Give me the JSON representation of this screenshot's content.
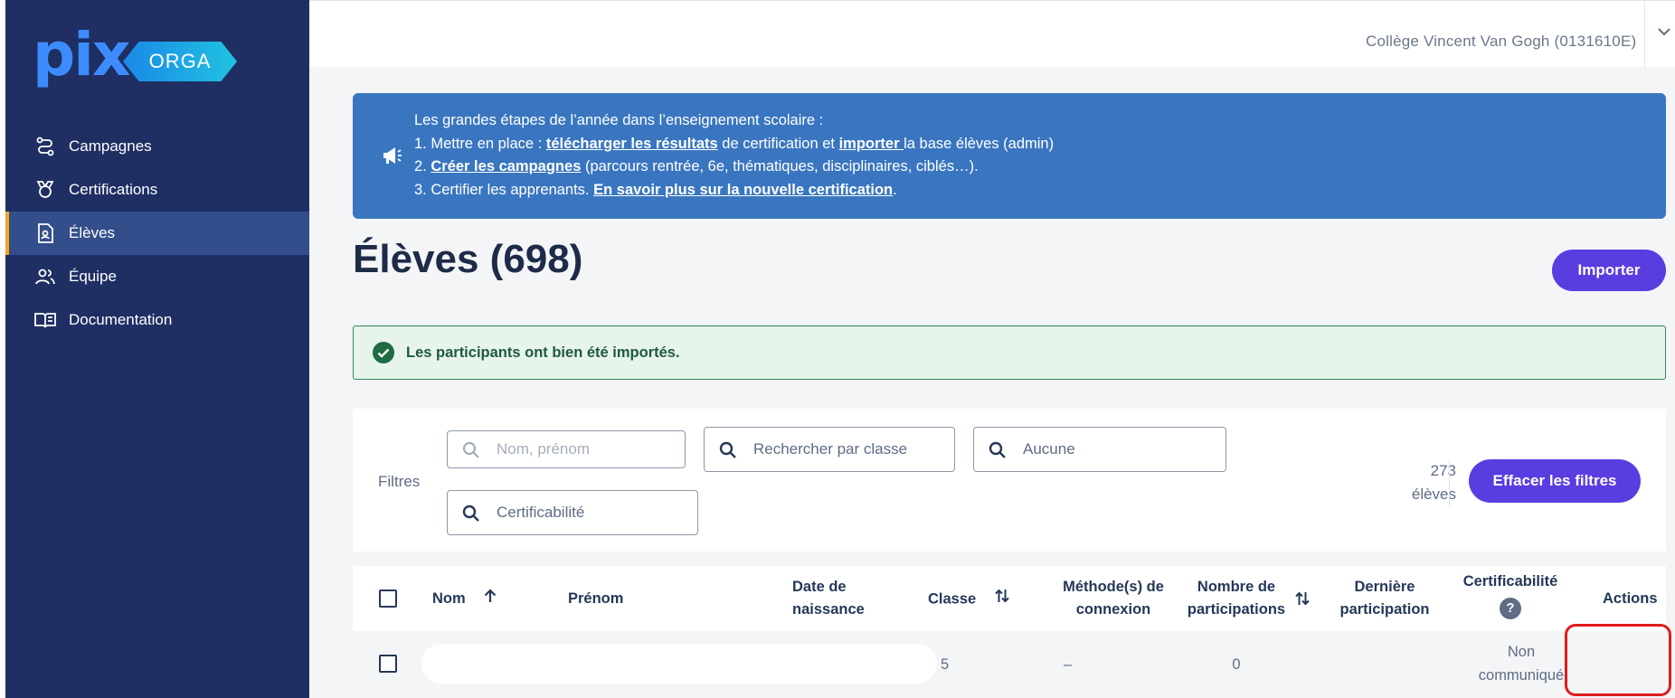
{
  "brand": {
    "name": "pix",
    "badge": "ORGA"
  },
  "sidebar": {
    "items": [
      {
        "label": "Campagnes",
        "icon": "campaign-icon"
      },
      {
        "label": "Certifications",
        "icon": "certification-icon"
      },
      {
        "label": "Élèves",
        "icon": "students-icon",
        "active": true
      },
      {
        "label": "Équipe",
        "icon": "team-icon"
      },
      {
        "label": "Documentation",
        "icon": "book-icon"
      }
    ]
  },
  "header": {
    "organization": "Collège Vincent Van Gogh (0131610E)"
  },
  "banner": {
    "intro": "Les grandes étapes de l’année dans l’enseignement scolaire :",
    "step1_prefix": "1. Mettre en place : ",
    "step1_link1": "télécharger les résultats",
    "step1_middle": " de certification et ",
    "step1_link2": "importer ",
    "step1_suffix": "la base élèves (admin)",
    "step2_prefix": "2. ",
    "step2_link": "Créer les campagnes",
    "step2_suffix": " (parcours rentrée, 6e, thématiques, disciplinaires, ciblés…).",
    "step3_prefix": "3. Certifier les apprenants. ",
    "step3_link": "En savoir plus sur la nouvelle certification",
    "step3_suffix": "."
  },
  "page": {
    "title": "Élèves (698)",
    "import_label": "Importer"
  },
  "success": {
    "message": "Les participants ont bien été importés."
  },
  "filters": {
    "label": "Filtres",
    "name_placeholder": "Nom, prénom",
    "class_placeholder": "Rechercher par classe",
    "connection_placeholder": "Aucune",
    "certif_placeholder": "Certificabilité",
    "count_number": "273",
    "count_unit": "élèves",
    "clear_label": "Effacer les filtres"
  },
  "table": {
    "headers": {
      "nom": "Nom",
      "prenom": "Prénom",
      "date_line1": "Date de",
      "date_line2": "naissance",
      "classe": "Classe",
      "methode_line1": "Méthode(s) de",
      "methode_line2": "connexion",
      "nombre_line1": "Nombre de",
      "nombre_line2": "participations",
      "derniere_line1": "Dernière",
      "derniere_line2": "participation",
      "certif": "Certificabilité",
      "actions": "Actions"
    },
    "rows": [
      {
        "classe": "5",
        "methode": "–",
        "participations": "0",
        "certif_line1": "Non",
        "certif_line2": "communiqué"
      }
    ]
  }
}
